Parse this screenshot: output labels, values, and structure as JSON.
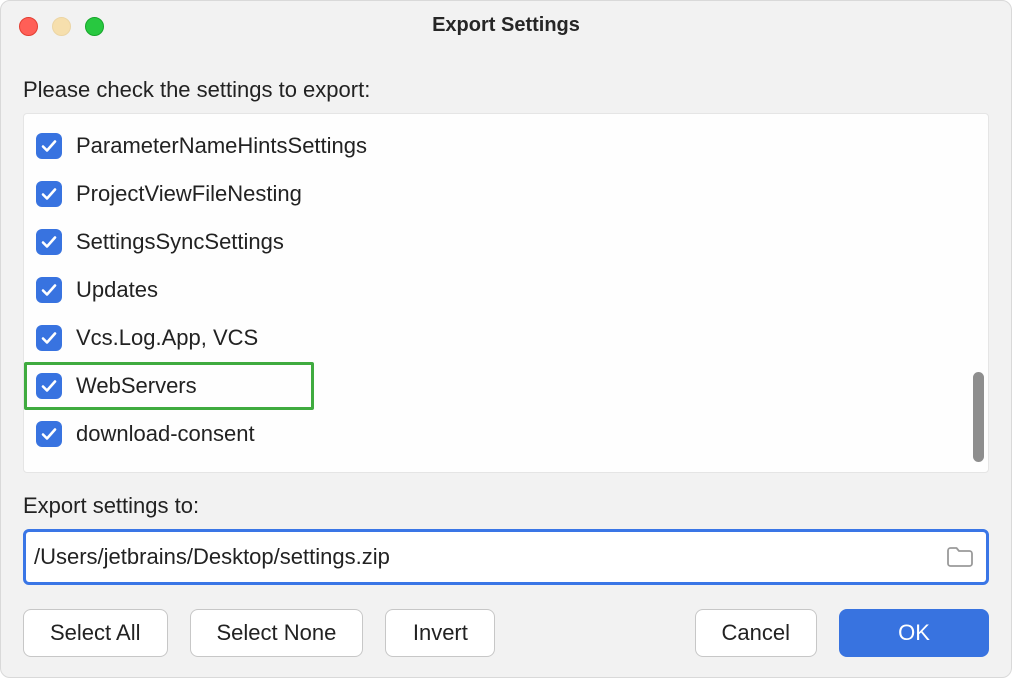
{
  "window": {
    "title": "Export Settings"
  },
  "prompt": "Please check the settings to export:",
  "settings": [
    {
      "label": "ParameterNameHintsSettings",
      "checked": true,
      "highlight": false
    },
    {
      "label": "ProjectViewFileNesting",
      "checked": true,
      "highlight": false
    },
    {
      "label": "SettingsSyncSettings",
      "checked": true,
      "highlight": false
    },
    {
      "label": "Updates",
      "checked": true,
      "highlight": false
    },
    {
      "label": "Vcs.Log.App, VCS",
      "checked": true,
      "highlight": false
    },
    {
      "label": "WebServers",
      "checked": true,
      "highlight": true
    },
    {
      "label": "download-consent",
      "checked": true,
      "highlight": false
    }
  ],
  "export": {
    "label": "Export settings to:",
    "path": "/Users/jetbrains/Desktop/settings.zip"
  },
  "buttons": {
    "select_all": "Select All",
    "select_none": "Select None",
    "invert": "Invert",
    "cancel": "Cancel",
    "ok": "OK"
  },
  "colors": {
    "accent": "#3873e0",
    "highlight": "#3fab3f"
  }
}
